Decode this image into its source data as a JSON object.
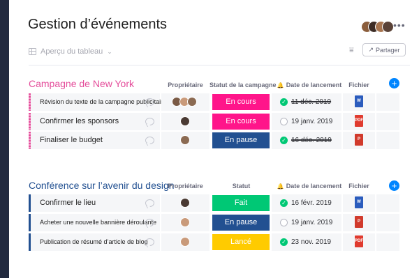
{
  "header": {
    "title": "Gestion d’événements",
    "view_label": "Aperçu du tableau",
    "share_label": "Partager",
    "more_label": "•••"
  },
  "groups": [
    {
      "title": "Campagne de New York",
      "color": "#e44c9a",
      "columns": {
        "owner": "Propriétaire",
        "status": "Statut de la campagne",
        "date": "Date de lancement",
        "file": "Fichier"
      },
      "rows": [
        {
          "name": "Révision du texte de la campagne publicitaire",
          "status": "En cours",
          "status_color": "#ff158a",
          "date": "11 déc. 2019",
          "done": true,
          "file": "word",
          "file_label": "W"
        },
        {
          "name": "Confirmer les sponsors",
          "status": "En cours",
          "status_color": "#ff158a",
          "date": "19 janv.  2019",
          "done": false,
          "file": "pdf",
          "file_label": "PDF"
        },
        {
          "name": "Finaliser le budget",
          "status": "En pause",
          "status_color": "#225091",
          "date": "16 déc. 2019",
          "done": true,
          "file": "ppt",
          "file_label": "P"
        }
      ]
    },
    {
      "title": "Conférence sur l’avenir du design",
      "color": "#225091",
      "columns": {
        "owner": "Propriétaire",
        "status": "Statut",
        "date": "Date de lancement",
        "file": "Fichier"
      },
      "rows": [
        {
          "name": "Confirmer le lieu",
          "status": "Fait",
          "status_color": "#00c875",
          "date": "16 févr. 2019",
          "done": true,
          "file": "word",
          "file_label": "W"
        },
        {
          "name": "Acheter une nouvelle bannière déroulante",
          "status": "En pause",
          "status_color": "#225091",
          "date": "19 janv. 2019",
          "done": false,
          "file": "ppt",
          "file_label": "P"
        },
        {
          "name": "Publication de résumé d’article de blog",
          "status": "Lancé",
          "status_color": "#ffcb00",
          "date": "23 nov. 2019",
          "done": true,
          "file": "pdf",
          "file_label": "PDF"
        }
      ]
    }
  ],
  "icons": {
    "check": "✓",
    "plus": "+",
    "chevron": "⌄",
    "filter": "⩸",
    "share": "↗"
  }
}
